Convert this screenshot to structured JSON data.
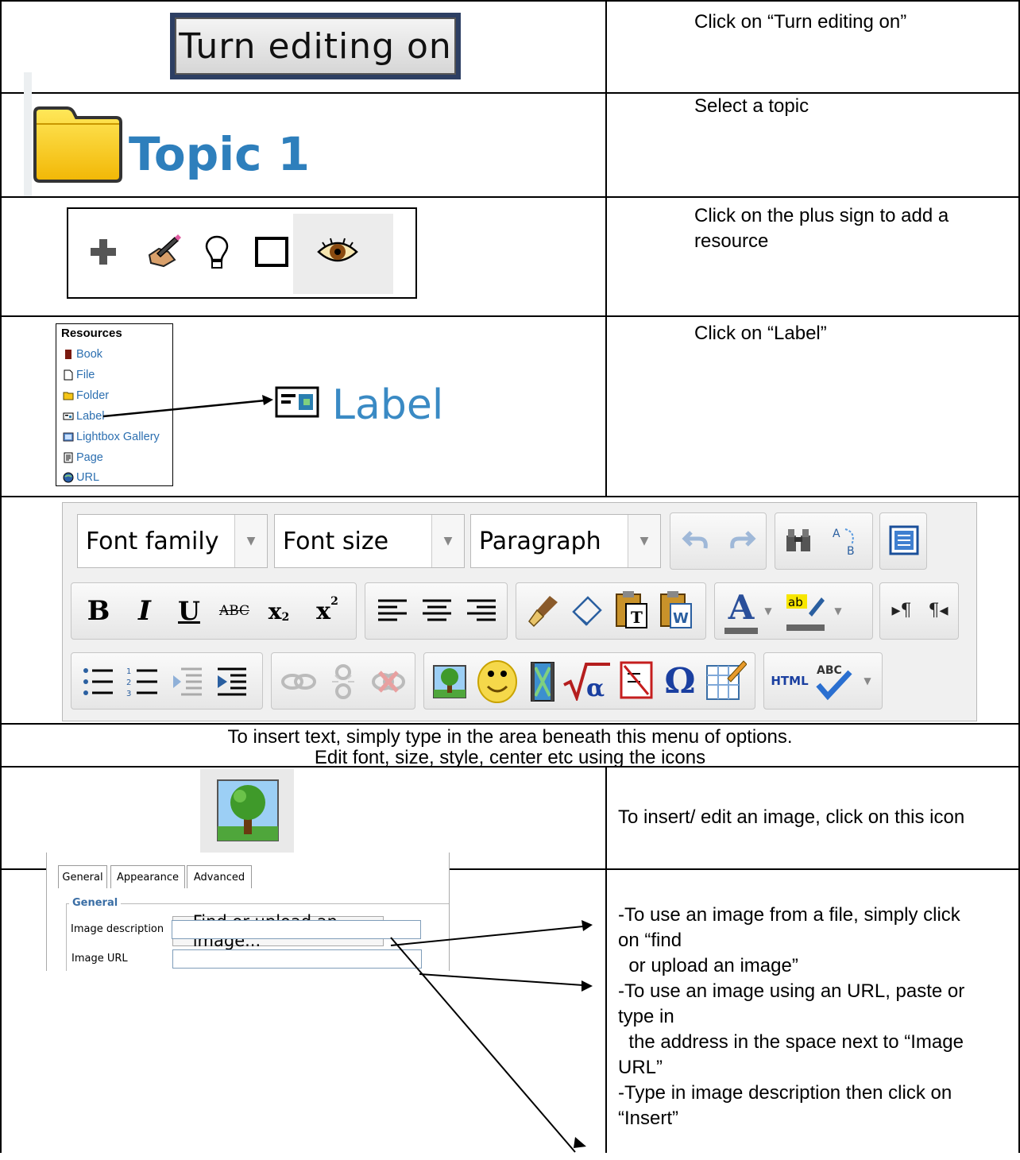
{
  "rows": {
    "r1": {
      "button_label": "Turn editing on",
      "instruction": "Click on “Turn editing on”"
    },
    "r2": {
      "topic_label": "Topic 1",
      "instruction": "Select a topic"
    },
    "r3": {
      "instruction_line1": "Click on the plus sign to add a",
      "instruction_line2": "resource"
    },
    "r4": {
      "resources_heading": "Resources",
      "items": [
        "Book",
        "File",
        "Folder",
        "Label",
        "Lightbox Gallery",
        "Page",
        "URL"
      ],
      "label_big": "Label",
      "instruction": "Click on “Label”"
    },
    "r5": {
      "font_family": "Font family",
      "font_size": "Font size",
      "paragraph": "Paragraph"
    },
    "r6": {
      "line1": "To insert text, simply type in the area beneath this menu of options.",
      "line2": "Edit font, size, style, center etc using the icons"
    },
    "r7": {
      "instruction": "To insert/ edit an image, click on this icon"
    },
    "r8": {
      "tabs": [
        "General",
        "Appearance",
        "Advanced"
      ],
      "legend": "General",
      "find_button": "Find or upload an image...",
      "image_url_label": "Image URL",
      "image_desc_label": "Image description",
      "lines": [
        "-To use an image from a file, simply click",
        "on “find",
        "  or upload an image”",
        "-To use an image using an URL, paste or",
        "type in",
        "  the address in the space next to “Image",
        "URL”",
        "-Type in image description then click on",
        "“Insert”"
      ]
    }
  }
}
